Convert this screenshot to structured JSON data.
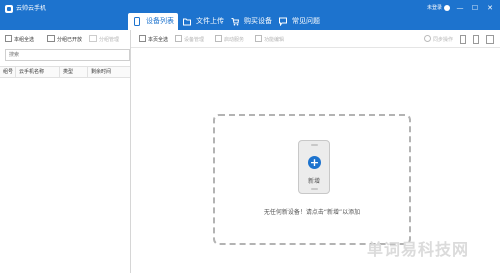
{
  "app": {
    "title": "云帅云手机",
    "user_label": "未登录"
  },
  "tabs": [
    {
      "label": "设备列表",
      "icon": "device-list-icon",
      "active": true
    },
    {
      "label": "文件上传",
      "icon": "folder-icon",
      "active": false
    },
    {
      "label": "购买设备",
      "icon": "cart-icon",
      "active": false
    },
    {
      "label": "常见问题",
      "icon": "help-icon",
      "active": false
    }
  ],
  "window_controls": {
    "minimize": "—",
    "maximize": "☐",
    "close": "✕"
  },
  "left_panel": {
    "select_all": "本组全选",
    "group_manage": "分组已开放",
    "move_to_group": "分组管理",
    "search_placeholder": "搜索",
    "columns": [
      "组号",
      "云手机名称",
      "类型",
      "剩余时间"
    ]
  },
  "right_panel": {
    "select_all": "本页全选",
    "toolbar": [
      "设备管理",
      "启动服务",
      "功能编辑"
    ],
    "sync_label": "同步操作"
  },
  "empty_state": {
    "new_label": "新增",
    "hint": "无任何新设备！请点击“新增”以添加"
  },
  "watermark": "单词易科技网",
  "colors": {
    "accent": "#1d73ce",
    "titlebar": "#1d73ce",
    "dash": "#b3b3b3"
  }
}
